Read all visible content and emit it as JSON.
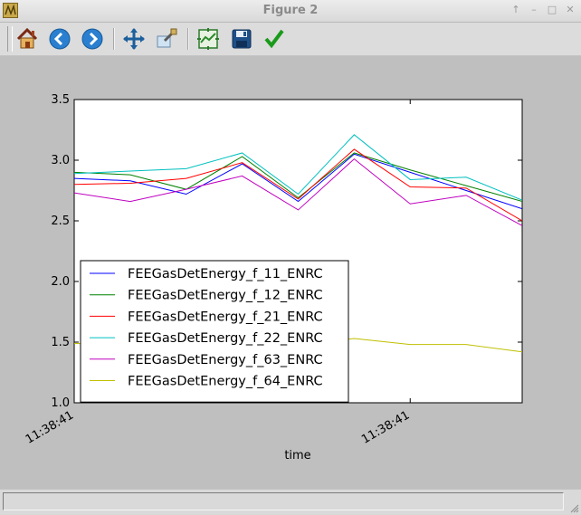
{
  "window": {
    "title": "Figure 2"
  },
  "toolbar": {
    "buttons": [
      {
        "name": "home-button",
        "icon": "home-icon"
      },
      {
        "name": "back-button",
        "icon": "back-arrow-icon"
      },
      {
        "name": "forward-button",
        "icon": "forward-arrow-icon"
      },
      {
        "name": "pan-button",
        "icon": "pan-arrows-icon"
      },
      {
        "name": "zoom-button",
        "icon": "zoom-rect-icon"
      },
      {
        "name": "subplots-button",
        "icon": "subplots-icon"
      },
      {
        "name": "save-button",
        "icon": "floppy-disk-icon"
      },
      {
        "name": "edit-axis-button",
        "icon": "checkmark-icon"
      }
    ]
  },
  "status": {
    "text": ""
  },
  "chart_data": {
    "type": "line",
    "title": "",
    "xlabel": "time",
    "ylabel": "",
    "ylim": [
      1.0,
      3.5
    ],
    "yticks": [
      "1.0",
      "1.5",
      "2.0",
      "2.5",
      "3.0",
      "3.5"
    ],
    "xticks": [
      "11:38:41",
      "11:38:41"
    ],
    "xlim": [
      0,
      8
    ],
    "xtick_positions": [
      0,
      6
    ],
    "grid": false,
    "legend_position": "lower-left",
    "x": [
      0,
      1,
      2,
      3,
      4,
      5,
      6,
      7,
      8
    ],
    "series": [
      {
        "name": "FEEGasDetEnergy_f_11_ENRC",
        "color": "#0000ff",
        "values": [
          2.85,
          2.83,
          2.72,
          2.97,
          2.66,
          3.05,
          2.9,
          2.75,
          2.6
        ]
      },
      {
        "name": "FEEGasDetEnergy_f_12_ENRC",
        "color": "#008000",
        "values": [
          2.9,
          2.88,
          2.76,
          3.03,
          2.69,
          3.06,
          2.92,
          2.79,
          2.66
        ]
      },
      {
        "name": "FEEGasDetEnergy_f_21_ENRC",
        "color": "#ff0000",
        "values": [
          2.8,
          2.81,
          2.85,
          2.98,
          2.68,
          3.09,
          2.78,
          2.77,
          2.5
        ]
      },
      {
        "name": "FEEGasDetEnergy_f_22_ENRC",
        "color": "#00bfbf",
        "values": [
          2.89,
          2.91,
          2.93,
          3.06,
          2.72,
          3.21,
          2.84,
          2.86,
          2.67
        ]
      },
      {
        "name": "FEEGasDetEnergy_f_63_ENRC",
        "color": "#bf00bf",
        "values": [
          2.73,
          2.66,
          2.76,
          2.87,
          2.59,
          3.01,
          2.64,
          2.71,
          2.46
        ]
      },
      {
        "name": "FEEGasDetEnergy_f_64_ENRC",
        "color": "#bfbf00",
        "values": [
          1.49,
          1.47,
          1.52,
          1.55,
          1.48,
          1.53,
          1.48,
          1.48,
          1.42
        ]
      }
    ]
  }
}
